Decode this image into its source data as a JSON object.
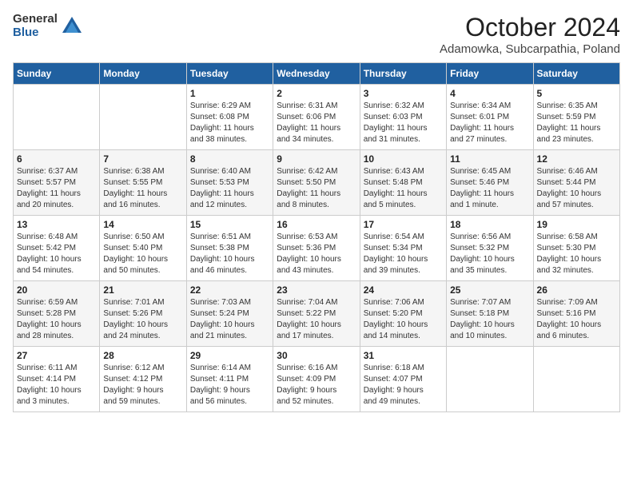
{
  "logo": {
    "general": "General",
    "blue": "Blue"
  },
  "title": "October 2024",
  "subtitle": "Adamowka, Subcarpathia, Poland",
  "days_of_week": [
    "Sunday",
    "Monday",
    "Tuesday",
    "Wednesday",
    "Thursday",
    "Friday",
    "Saturday"
  ],
  "weeks": [
    [
      {
        "num": "",
        "info": ""
      },
      {
        "num": "",
        "info": ""
      },
      {
        "num": "1",
        "info": "Sunrise: 6:29 AM\nSunset: 6:08 PM\nDaylight: 11 hours\nand 38 minutes."
      },
      {
        "num": "2",
        "info": "Sunrise: 6:31 AM\nSunset: 6:06 PM\nDaylight: 11 hours\nand 34 minutes."
      },
      {
        "num": "3",
        "info": "Sunrise: 6:32 AM\nSunset: 6:03 PM\nDaylight: 11 hours\nand 31 minutes."
      },
      {
        "num": "4",
        "info": "Sunrise: 6:34 AM\nSunset: 6:01 PM\nDaylight: 11 hours\nand 27 minutes."
      },
      {
        "num": "5",
        "info": "Sunrise: 6:35 AM\nSunset: 5:59 PM\nDaylight: 11 hours\nand 23 minutes."
      }
    ],
    [
      {
        "num": "6",
        "info": "Sunrise: 6:37 AM\nSunset: 5:57 PM\nDaylight: 11 hours\nand 20 minutes."
      },
      {
        "num": "7",
        "info": "Sunrise: 6:38 AM\nSunset: 5:55 PM\nDaylight: 11 hours\nand 16 minutes."
      },
      {
        "num": "8",
        "info": "Sunrise: 6:40 AM\nSunset: 5:53 PM\nDaylight: 11 hours\nand 12 minutes."
      },
      {
        "num": "9",
        "info": "Sunrise: 6:42 AM\nSunset: 5:50 PM\nDaylight: 11 hours\nand 8 minutes."
      },
      {
        "num": "10",
        "info": "Sunrise: 6:43 AM\nSunset: 5:48 PM\nDaylight: 11 hours\nand 5 minutes."
      },
      {
        "num": "11",
        "info": "Sunrise: 6:45 AM\nSunset: 5:46 PM\nDaylight: 11 hours\nand 1 minute."
      },
      {
        "num": "12",
        "info": "Sunrise: 6:46 AM\nSunset: 5:44 PM\nDaylight: 10 hours\nand 57 minutes."
      }
    ],
    [
      {
        "num": "13",
        "info": "Sunrise: 6:48 AM\nSunset: 5:42 PM\nDaylight: 10 hours\nand 54 minutes."
      },
      {
        "num": "14",
        "info": "Sunrise: 6:50 AM\nSunset: 5:40 PM\nDaylight: 10 hours\nand 50 minutes."
      },
      {
        "num": "15",
        "info": "Sunrise: 6:51 AM\nSunset: 5:38 PM\nDaylight: 10 hours\nand 46 minutes."
      },
      {
        "num": "16",
        "info": "Sunrise: 6:53 AM\nSunset: 5:36 PM\nDaylight: 10 hours\nand 43 minutes."
      },
      {
        "num": "17",
        "info": "Sunrise: 6:54 AM\nSunset: 5:34 PM\nDaylight: 10 hours\nand 39 minutes."
      },
      {
        "num": "18",
        "info": "Sunrise: 6:56 AM\nSunset: 5:32 PM\nDaylight: 10 hours\nand 35 minutes."
      },
      {
        "num": "19",
        "info": "Sunrise: 6:58 AM\nSunset: 5:30 PM\nDaylight: 10 hours\nand 32 minutes."
      }
    ],
    [
      {
        "num": "20",
        "info": "Sunrise: 6:59 AM\nSunset: 5:28 PM\nDaylight: 10 hours\nand 28 minutes."
      },
      {
        "num": "21",
        "info": "Sunrise: 7:01 AM\nSunset: 5:26 PM\nDaylight: 10 hours\nand 24 minutes."
      },
      {
        "num": "22",
        "info": "Sunrise: 7:03 AM\nSunset: 5:24 PM\nDaylight: 10 hours\nand 21 minutes."
      },
      {
        "num": "23",
        "info": "Sunrise: 7:04 AM\nSunset: 5:22 PM\nDaylight: 10 hours\nand 17 minutes."
      },
      {
        "num": "24",
        "info": "Sunrise: 7:06 AM\nSunset: 5:20 PM\nDaylight: 10 hours\nand 14 minutes."
      },
      {
        "num": "25",
        "info": "Sunrise: 7:07 AM\nSunset: 5:18 PM\nDaylight: 10 hours\nand 10 minutes."
      },
      {
        "num": "26",
        "info": "Sunrise: 7:09 AM\nSunset: 5:16 PM\nDaylight: 10 hours\nand 6 minutes."
      }
    ],
    [
      {
        "num": "27",
        "info": "Sunrise: 6:11 AM\nSunset: 4:14 PM\nDaylight: 10 hours\nand 3 minutes."
      },
      {
        "num": "28",
        "info": "Sunrise: 6:12 AM\nSunset: 4:12 PM\nDaylight: 9 hours\nand 59 minutes."
      },
      {
        "num": "29",
        "info": "Sunrise: 6:14 AM\nSunset: 4:11 PM\nDaylight: 9 hours\nand 56 minutes."
      },
      {
        "num": "30",
        "info": "Sunrise: 6:16 AM\nSunset: 4:09 PM\nDaylight: 9 hours\nand 52 minutes."
      },
      {
        "num": "31",
        "info": "Sunrise: 6:18 AM\nSunset: 4:07 PM\nDaylight: 9 hours\nand 49 minutes."
      },
      {
        "num": "",
        "info": ""
      },
      {
        "num": "",
        "info": ""
      }
    ]
  ]
}
